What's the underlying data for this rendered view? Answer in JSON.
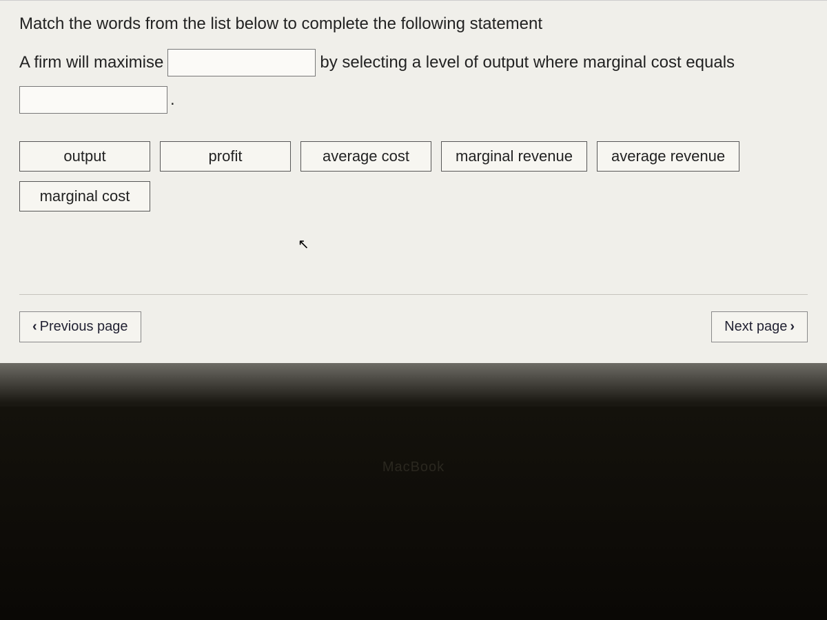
{
  "instruction": "Match the words from the list below to complete the following statement",
  "statement": {
    "part1": "A firm will maximise",
    "part2": "by selecting a level of output where marginal cost equals",
    "period": "."
  },
  "word_bank": [
    "output",
    "profit",
    "average cost",
    "marginal revenue",
    "average revenue",
    "marginal cost"
  ],
  "nav": {
    "previous": "Previous page",
    "next": "Next page"
  },
  "device": "MacBook"
}
